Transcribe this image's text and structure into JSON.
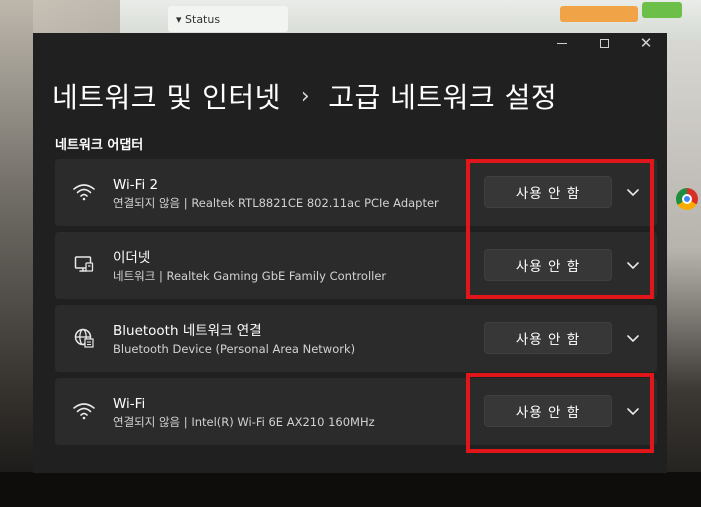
{
  "background": {
    "status_card_label": "▾ Status"
  },
  "window": {
    "breadcrumb": {
      "parent": "네트워크 및 인터넷",
      "separator": "›",
      "current": "고급 네트워크 설정"
    },
    "section_title": "네트워크 어댑터",
    "adapters": [
      {
        "icon": "wifi-icon",
        "name": "Wi-Fi 2",
        "description": "연결되지 않음 | Realtek RTL8821CE 802.11ac PCIe Adapter",
        "button_label": "사용 안 함",
        "highlighted": true
      },
      {
        "icon": "ethernet-icon",
        "name": "이더넷",
        "description": "네트워크 | Realtek Gaming GbE Family Controller",
        "button_label": "사용 안 함",
        "highlighted": true
      },
      {
        "icon": "bluetooth-network-icon",
        "name": "Bluetooth 네트워크 연결",
        "description": "Bluetooth Device (Personal Area Network)",
        "button_label": "사용 안 함",
        "highlighted": false
      },
      {
        "icon": "wifi-icon",
        "name": "Wi-Fi",
        "description": "연결되지 않음 | Intel(R) Wi-Fi 6E AX210 160MHz",
        "button_label": "사용 안 함",
        "highlighted": true
      }
    ]
  },
  "colors": {
    "window_bg": "#202020",
    "row_bg": "#2b2b2b",
    "button_bg": "#373737",
    "highlight": "#e0161b"
  }
}
